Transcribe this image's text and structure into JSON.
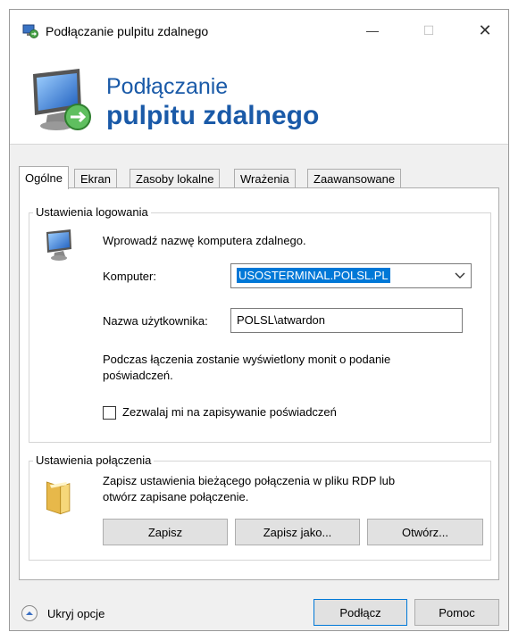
{
  "window": {
    "title": "Podłączanie pulpitu zdalnego",
    "minimize_glyph": "—",
    "maximize_glyph": "☐",
    "close_glyph": "✕"
  },
  "banner": {
    "line1": "Podłączanie",
    "line2": "pulpitu zdalnego"
  },
  "tabs": [
    {
      "label": "Ogólne",
      "active": true
    },
    {
      "label": "Ekran",
      "active": false
    },
    {
      "label": "Zasoby lokalne",
      "active": false
    },
    {
      "label": "Wrażenia",
      "active": false
    },
    {
      "label": "Zaawansowane",
      "active": false
    }
  ],
  "login_settings": {
    "title": "Ustawienia logowania",
    "prompt": "Wprowadź nazwę komputera zdalnego.",
    "computer_label": "Komputer:",
    "computer_value": "USOSTERMINAL.POLSL.PL",
    "username_label": "Nazwa użytkownika:",
    "username_value": "POLSL\\atwardon",
    "credentials_note_line1": "Podczas łączenia zostanie wyświetlony monit o podanie",
    "credentials_note_line2": "poświadczeń.",
    "save_credentials_label": "Zezwalaj mi na zapisywanie poświadczeń",
    "save_credentials_checked": false
  },
  "connection_settings": {
    "title": "Ustawienia połączenia",
    "description_line1": "Zapisz ustawienia bieżącego połączenia w pliku RDP lub",
    "description_line2": "otwórz zapisane połączenie.",
    "save_button": "Zapisz",
    "save_as_button": "Zapisz jako...",
    "open_button": "Otwórz..."
  },
  "footer": {
    "hide_options": "Ukryj opcje",
    "connect_button": "Podłącz",
    "help_button": "Pomoc"
  }
}
